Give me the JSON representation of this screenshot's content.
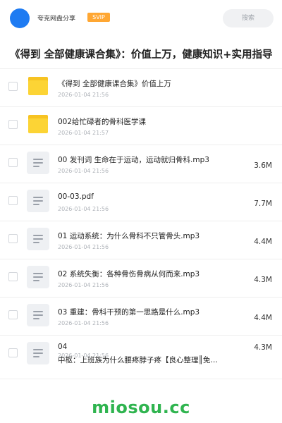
{
  "header": {
    "app_name": "夸克网盘分享",
    "badge": "SVIP",
    "search_label": "搜索",
    "avatar_color": "#1e7bf2"
  },
  "folder_title": "《得到 全部健康课合集》：价值上万，健康知识+实用指导",
  "files": [
    {
      "name": "《得到 全部健康课合集》价值上万",
      "date": "2026-01-04 21:56",
      "size": "",
      "icon": "folder-icon"
    },
    {
      "name": "002给忙碌者的骨科医学课",
      "date": "2026-01-04 21:57",
      "size": "",
      "icon": "folder-icon"
    },
    {
      "name": "00 发刊词 生命在于运动，运动就归骨科.mp3",
      "date": "2026-01-04 21:56",
      "size": "3.6M",
      "icon": "document-icon"
    },
    {
      "name": "00-03.pdf",
      "date": "2026-01-04 21:56",
      "size": "7.7M",
      "icon": "document-icon"
    },
    {
      "name": "01  运动系统：为什么骨科不只管骨头.mp3",
      "date": "2026-01-04 21:56",
      "size": "4.4M",
      "icon": "document-icon"
    },
    {
      "name": "02  系统失衡：各种骨伤骨病从何而来.mp3",
      "date": "2026-01-04 21:56",
      "size": "4.3M",
      "icon": "document-icon"
    },
    {
      "name": "03  重建：骨科干预的第一思路是什么.mp3",
      "date": "2026-01-04 21:56",
      "size": "4.4M",
      "icon": "document-icon"
    },
    {
      "name": "04",
      "name_line2": "中枢：上班族为什么腰疼脖子疼【良心整理║免…",
      "date": "2026-01-04 21:56",
      "size": "4.3M",
      "icon": "document-icon"
    }
  ],
  "watermark": "miosou.cc",
  "colors": {
    "folder": "#fcd435",
    "badge": "#ffa733",
    "watermark": "#2fb44f"
  }
}
